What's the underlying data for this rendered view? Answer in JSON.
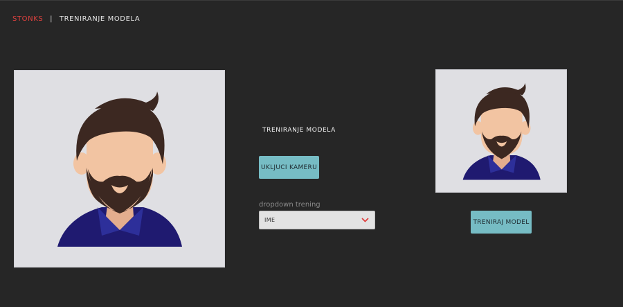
{
  "header": {
    "brand": "STONKS",
    "separator": "|",
    "page_title": "TRENIRANJE MODELA"
  },
  "main": {
    "section_title": "TRENIRANJE MODELA",
    "camera_button_label": "UKLJUCI KAMERU",
    "dropdown_label": "dropdown trening",
    "dropdown_value": "IME",
    "train_button_label": "TRENIRAJ MODEL"
  },
  "images": {
    "main_camera_icon": "person-avatar-icon",
    "preview_icon": "person-avatar-icon"
  },
  "colors": {
    "background": "#262626",
    "brand": "#e0413f",
    "button": "#76bcc4",
    "dropdown_arrow": "#e0413f"
  }
}
